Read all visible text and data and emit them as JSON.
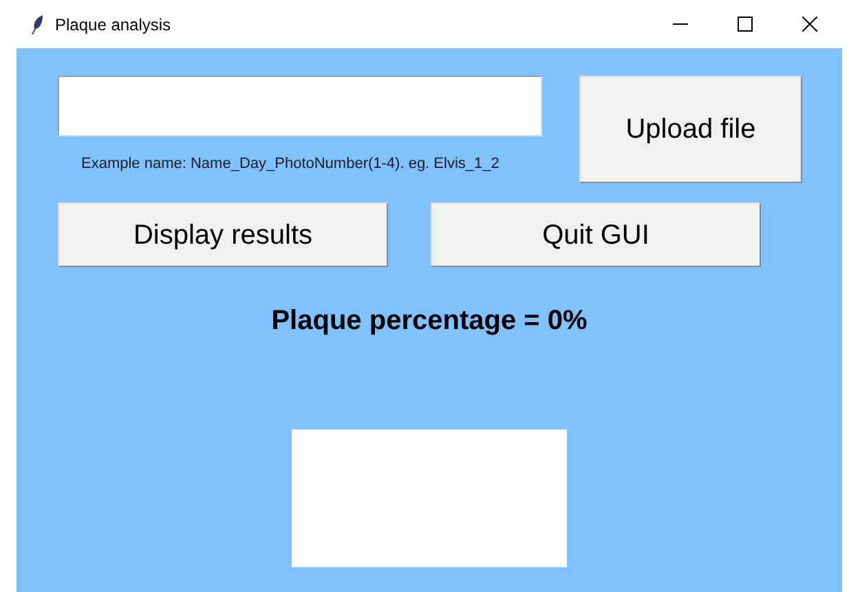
{
  "window": {
    "title": "Plaque analysis"
  },
  "file_field": {
    "hint": "Example name: Name_Day_PhotoNumber(1-4). eg. Elvis_1_2"
  },
  "buttons": [
    {
      "label": "Upload file"
    },
    {
      "label": "Display results"
    },
    {
      "label": "Quit GUI"
    }
  ],
  "result": "Plaque percentage = 0%"
}
